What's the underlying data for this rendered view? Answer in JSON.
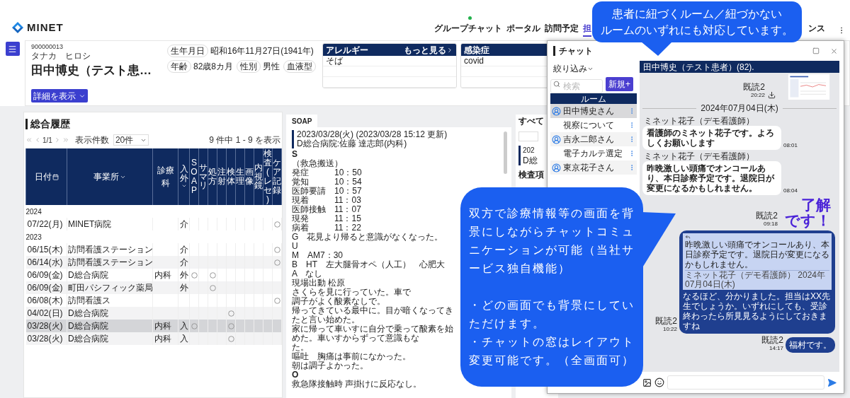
{
  "logo": {
    "text": "MINET"
  },
  "nav": [
    {
      "label": "グループチャット",
      "selected": false,
      "notification": true
    },
    {
      "label": "ポータル",
      "selected": false,
      "notification": false
    },
    {
      "label": "訪問予定",
      "selected": false,
      "notification": false
    },
    {
      "label": "担",
      "selected": true,
      "notification": false
    },
    {
      "label": "ンス",
      "selected": false,
      "notification": false
    }
  ],
  "patient": {
    "id": "900000013",
    "kana": "タナカ　ヒロシ",
    "name": "田中博史（テスト患…",
    "details_button": "詳細を表示",
    "fields": [
      {
        "label": "生年月日",
        "value": "昭和16年11月27日(1941年)"
      },
      {
        "label": "年齢",
        "value": "82歳8カ月"
      },
      {
        "label": "性別",
        "value": "男性"
      },
      {
        "label": "血液型"
      }
    ]
  },
  "allergy": {
    "title": "アレルギー",
    "more": "もっと見る",
    "rows": [
      "そば"
    ]
  },
  "infection": {
    "title": "感染症",
    "rows": [
      "covid"
    ]
  },
  "history": {
    "title": "総合履歴",
    "page": "1/1",
    "page_size_label": "表示件数",
    "page_size": "20件",
    "summary": "9 件中 1 - 9 を表示",
    "columns": [
      {
        "label": "日付",
        "kind": "date"
      },
      {
        "label": "事業所",
        "kind": "filter"
      },
      {
        "label": "診療科",
        "kind": "text"
      },
      {
        "label": "入外",
        "kind": "filter_vertical"
      },
      {
        "label": "SOAP",
        "kind": "mark"
      },
      {
        "label": "サマリ",
        "kind": "mark"
      },
      {
        "label": "処方",
        "kind": "mark"
      },
      {
        "label": "注射",
        "kind": "mark"
      },
      {
        "label": "検体",
        "kind": "mark"
      },
      {
        "label": "生理",
        "kind": "mark"
      },
      {
        "label": "画像",
        "kind": "mark"
      },
      {
        "label": "内視鏡",
        "kind": "mark"
      },
      {
        "label": "検査(レセ)",
        "kind": "mark"
      },
      {
        "label": "ケア記録",
        "kind": "mark"
      }
    ],
    "groups": [
      {
        "year": "2024",
        "rows": [
          {
            "date": "07/22(月)",
            "office": "MINET病院",
            "io": "介",
            "selected": false,
            "marks": [
              false,
              false,
              false,
              false,
              false,
              false,
              false,
              false,
              false,
              true
            ]
          }
        ]
      },
      {
        "year": "2023",
        "rows": [
          {
            "date": "06/15(木)",
            "office": "訪問看護ステーション",
            "io": "介",
            "selected": false,
            "marks": [
              false,
              false,
              false,
              false,
              false,
              false,
              false,
              false,
              false,
              true
            ]
          },
          {
            "date": "06/14(水)",
            "office": "訪問看護ステーション",
            "io": "介",
            "selected": false,
            "marks": [
              false,
              false,
              false,
              false,
              false,
              false,
              false,
              false,
              false,
              true
            ]
          },
          {
            "date": "06/09(金)",
            "office": "D総合病院",
            "dept": "内科",
            "io": "外",
            "selected": false,
            "marks": [
              true,
              false,
              true,
              false,
              false,
              false,
              false,
              false,
              false,
              false
            ]
          },
          {
            "date": "06/09(金)",
            "office": "町田パシフィック薬局",
            "io": "外",
            "selected": false,
            "marks": [
              false,
              false,
              true,
              false,
              false,
              false,
              false,
              false,
              false,
              false
            ]
          },
          {
            "date": "06/08(木)",
            "office": "訪問看護ス",
            "selected": false,
            "marks": [
              false,
              false,
              false,
              false,
              false,
              false,
              false,
              false,
              false,
              true
            ]
          },
          {
            "date": "04/02(日)",
            "office": "D総合病院",
            "selected": false,
            "marks": [
              false,
              false,
              false,
              false,
              true,
              false,
              false,
              false,
              false,
              false
            ]
          },
          {
            "date": "03/28(火)",
            "office": "D総合病院",
            "dept": "内科",
            "io": "入",
            "selected": true,
            "marks": [
              true,
              false,
              false,
              false,
              true,
              false,
              false,
              false,
              false,
              false
            ]
          },
          {
            "date": "03/28(火)",
            "office": "D総合病院",
            "dept": "内科",
            "io": "入",
            "selected": false,
            "marks": [
              false,
              false,
              false,
              false,
              true,
              false,
              false,
              false,
              false,
              false
            ]
          }
        ]
      }
    ]
  },
  "soap": {
    "tab": "SOAP",
    "entry": {
      "date": "2023/03/28(火) (2023/03/28 15:12 更新)",
      "author": "D総合病院:佐藤 達志郎(内科)"
    },
    "lines": [
      {
        "kind": "section",
        "text": "S"
      },
      {
        "kind": "text",
        "text": "（救急搬送）"
      },
      {
        "kind": "time",
        "label": "発症",
        "time": "10：50"
      },
      {
        "kind": "time",
        "label": "覚知",
        "time": "10：54"
      },
      {
        "kind": "time",
        "label": "医師要請",
        "time": "10：57"
      },
      {
        "kind": "time",
        "label": "現着",
        "time": "11：03"
      },
      {
        "kind": "time",
        "label": "医師接触",
        "time": "11：07"
      },
      {
        "kind": "time",
        "label": "現発",
        "time": "11：15"
      },
      {
        "kind": "time",
        "label": "病着",
        "time": "11：22"
      },
      {
        "kind": "text",
        "text": "G　花見より帰ると意識がなくなった。"
      },
      {
        "kind": "text",
        "text": "U"
      },
      {
        "kind": "text",
        "text": "M　AM7：30"
      },
      {
        "kind": "text",
        "text": "B　HT　左大腿骨オペ（人工）　心肥大"
      },
      {
        "kind": "text",
        "text": "A　なし"
      },
      {
        "kind": "text",
        "text": "現場出動 松原"
      },
      {
        "kind": "text",
        "text": "さくらを見に行っていた。車で"
      },
      {
        "kind": "text",
        "text": "調子がよく酸素なしで。"
      },
      {
        "kind": "text",
        "text": "帰ってきている最中に。目が暗くなってきたと言い始めた。"
      },
      {
        "kind": "text",
        "text": "家に帰って車いすに自分で乗って酸素を始めた。車いすからずって意識もな"
      },
      {
        "kind": "text",
        "text": "た。"
      },
      {
        "kind": "text",
        "text": "嘔吐　胸痛は事前になかった。"
      },
      {
        "kind": "text",
        "text": "朝は調子よかった。"
      },
      {
        "kind": "section",
        "text": "O"
      },
      {
        "kind": "text",
        "text": "救急隊接触時 声掛けに反応なし。"
      }
    ]
  },
  "all_panel": {
    "tab": "すべて",
    "entry": {
      "date": "202",
      "author": "D総"
    },
    "label": "検査項"
  },
  "chat": {
    "title": "チャット",
    "filter": "絞り込み",
    "search_placeholder": "検索",
    "new_button": "新規+",
    "rooms_header": "ルーム",
    "rooms": [
      {
        "name": "田中博史さん",
        "kind": "patient",
        "selected": true
      },
      {
        "name": "視察について",
        "kind": "topic",
        "selected": false
      },
      {
        "name": "吉永二郎さん",
        "kind": "patient",
        "selected": false
      },
      {
        "name": "電子カルテ選定",
        "kind": "topic",
        "selected": false
      },
      {
        "name": "東京花子さん",
        "kind": "patient",
        "selected": false
      }
    ],
    "room_title": "田中博史（テスト患者）(82).",
    "messages": [
      {
        "kind": "image",
        "read": "既読2",
        "time": "20:22"
      },
      {
        "kind": "date",
        "text": "2024年07月04日(木)"
      },
      {
        "kind": "incoming",
        "sender": "ミネット花子（デモ看護師）",
        "text": "看護師のミネット花子です。よろしくお願いします",
        "time": "08:01"
      },
      {
        "kind": "incoming",
        "sender": "ミネット花子（デモ看護師）",
        "text": "昨晩激しい頭痛でオンコールあり、本日診察予定です。退院日が変更になるかもしれません。",
        "time": "08:04"
      },
      {
        "kind": "sticker",
        "lines": [
          "了解",
          "です！"
        ],
        "read": "既読2",
        "time": "09:18"
      },
      {
        "kind": "outgoing",
        "quote": {
          "text": "昨晩激しい頭痛でオンコールあり、本日診察予定です。退院日が変更になるかもしれません。",
          "meta": "ミネット花子（デモ看護師） 2024年07月04日(木)"
        },
        "text": "なるほど、分かりました。担当はXX先生でしょうか。いずれにしても、受診終わったら所見見るようにしておきますね",
        "read": "既読2",
        "time": "10:22"
      },
      {
        "kind": "outgoing",
        "text": "福村です。",
        "read": "既読2",
        "time": "14:17"
      }
    ]
  },
  "top_callout": {
    "lines": [
      "患者に紐づくルーム／紐づかない",
      "ルームのいずれにも対応しています。"
    ]
  },
  "side_callout": {
    "paragraphs": [
      "双方で診療情報等の画面を背景にしながらチャットコミュニケーションが可能（当社サービス独自機能）",
      "・どの画面でも背景にしていただけます。",
      "・チャットの窓はレイアウト変更可能です。（全画面可）"
    ]
  }
}
